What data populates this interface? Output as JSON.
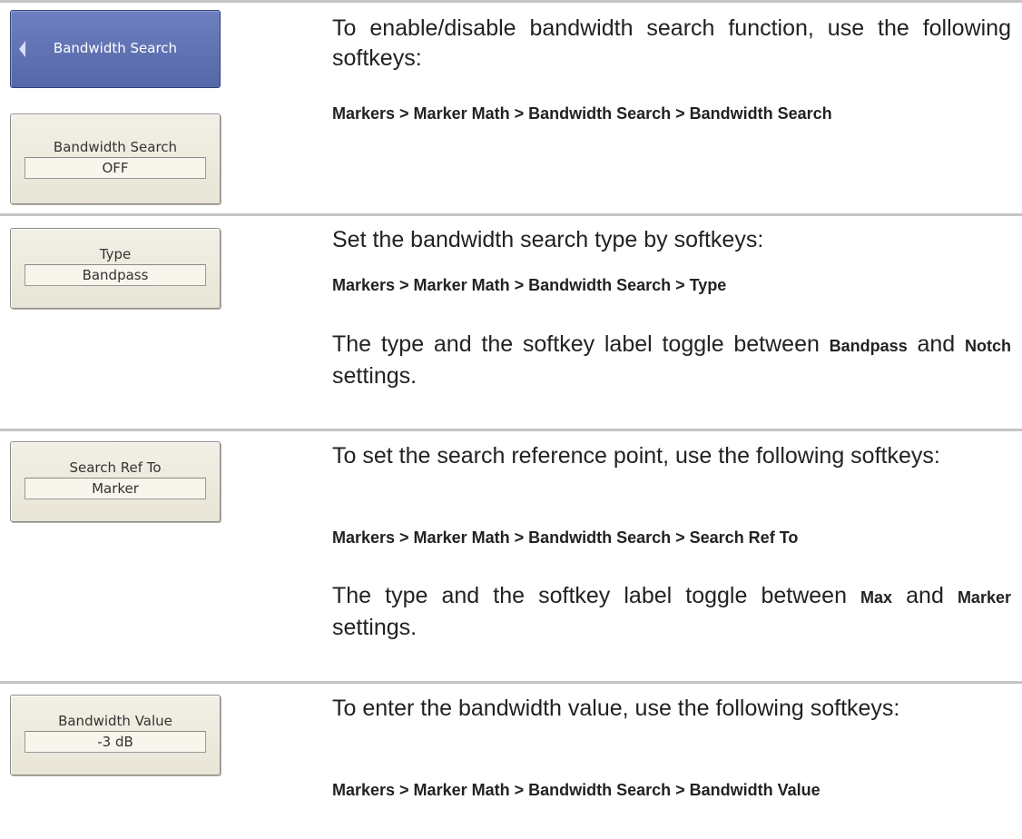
{
  "sections": [
    {
      "softkeys": [
        {
          "label": "Bandwidth Search",
          "is_submenu": true
        },
        {
          "label": "Bandwidth Search",
          "value": "OFF"
        }
      ],
      "text": "To enable/disable bandwidth search function, use the following softkeys:",
      "path": "Markers > Marker Math > Bandwidth Search > Bandwidth Search"
    },
    {
      "softkeys": [
        {
          "label": "Type",
          "value": "Bandpass"
        }
      ],
      "text": "Set the bandwidth search type by softkeys:",
      "path": "Markers > Marker Math > Bandwidth Search > Type",
      "note": {
        "prefix": "The type and the softkey label toggle between",
        "option1": "Bandpass",
        "middle": "and",
        "option2": "Notch",
        "suffix": "settings."
      }
    },
    {
      "softkeys": [
        {
          "label": "Search Ref To",
          "value": "Marker"
        }
      ],
      "text": "To set the search reference point, use the following softkeys:",
      "path": "Markers > Marker Math > Bandwidth Search > Search Ref To",
      "note": {
        "prefix": "The type and the softkey label toggle between",
        "option1": "Max",
        "middle": "and",
        "option2": "Marker",
        "suffix": "settings."
      }
    },
    {
      "softkeys": [
        {
          "label": "Bandwidth Value",
          "value": "-3 dB"
        }
      ],
      "text": "To enter the bandwidth value, use the following softkeys:",
      "path": "Markers > Marker Math > Bandwidth Search > Bandwidth Value"
    }
  ],
  "colors": {
    "submenu_key": "#5f70b0",
    "softkey_face": "#ece9d8",
    "rule": "#c4c4c4"
  }
}
